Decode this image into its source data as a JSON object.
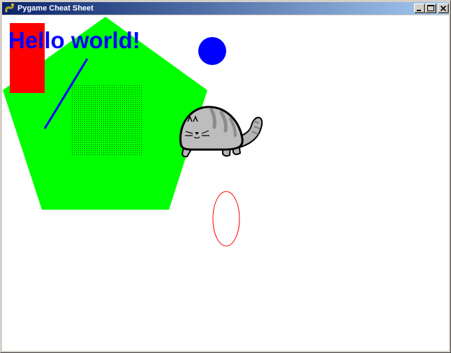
{
  "window": {
    "title": "Pygame Cheat Sheet",
    "app_icon": "pygame-snake-icon",
    "controls": {
      "minimize_icon": "minimize-icon",
      "maximize_icon": "maximize-icon",
      "close_icon": "close-icon"
    }
  },
  "canvas": {
    "background_color": "#ffffff",
    "text": {
      "content": "Hello world!",
      "color": "#0000ff"
    },
    "polygon_color": "#00ff00",
    "rectangle_color": "#ff0000",
    "line_color": "#0000ff",
    "circle_color": "#0000ff",
    "ellipse_color": "#ff0000",
    "dotted_square_color": "#006400",
    "cat_sprite": "cat-icon"
  }
}
